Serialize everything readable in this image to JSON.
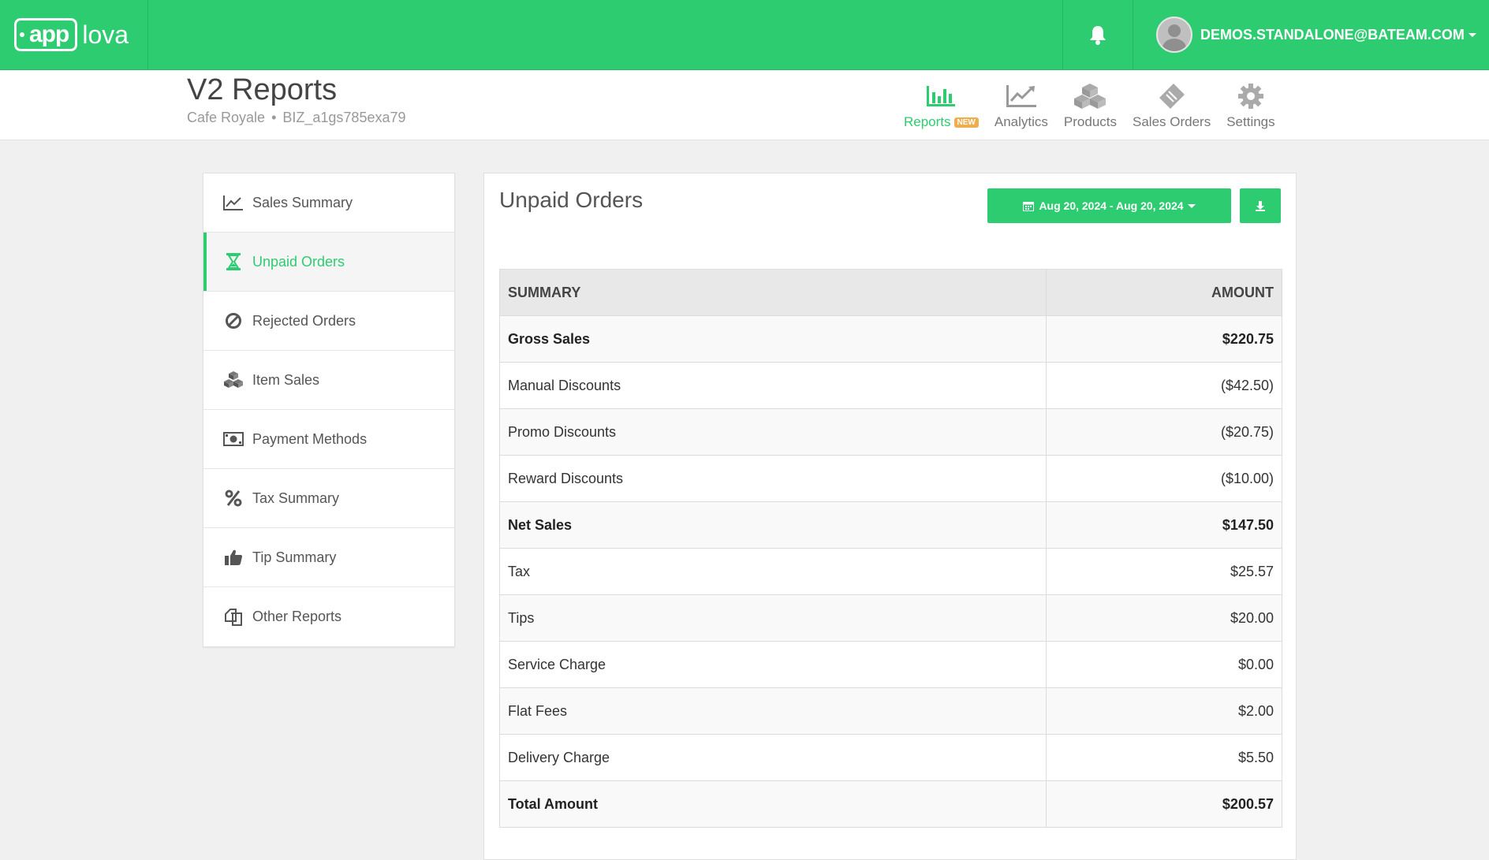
{
  "brand": {
    "logo_app": "app",
    "logo_rest": "lova"
  },
  "user": {
    "email": "DEMOS.STANDALONE@BATEAM.COM"
  },
  "header": {
    "title": "V2 Reports",
    "business": "Cafe Royale",
    "business_id": "BIZ_a1gs785exa79"
  },
  "nav": [
    {
      "label": "Reports",
      "badge": "NEW",
      "icon": "bar-chart-icon",
      "active": true
    },
    {
      "label": "Analytics",
      "icon": "line-chart-icon"
    },
    {
      "label": "Products",
      "icon": "cubes-icon"
    },
    {
      "label": "Sales Orders",
      "icon": "ticket-icon"
    },
    {
      "label": "Settings",
      "icon": "gear-icon"
    }
  ],
  "sidebar": {
    "items": [
      {
        "label": "Sales Summary",
        "icon": "line-chart-icon"
      },
      {
        "label": "Unpaid Orders",
        "icon": "hourglass-icon",
        "active": true
      },
      {
        "label": "Rejected Orders",
        "icon": "ban-icon"
      },
      {
        "label": "Item Sales",
        "icon": "cubes-icon"
      },
      {
        "label": "Payment Methods",
        "icon": "money-icon"
      },
      {
        "label": "Tax Summary",
        "icon": "percent-icon"
      },
      {
        "label": "Tip Summary",
        "icon": "thumbs-up-icon"
      },
      {
        "label": "Other Reports",
        "icon": "copy-icon"
      }
    ]
  },
  "main": {
    "title": "Unpaid Orders",
    "date_range": "Aug 20, 2024 - Aug 20, 2024",
    "table": {
      "headers": [
        "SUMMARY",
        "AMOUNT"
      ],
      "rows": [
        {
          "label": "Gross Sales",
          "amount": "$220.75",
          "bold": true
        },
        {
          "label": "Manual Discounts",
          "amount": "($42.50)"
        },
        {
          "label": "Promo Discounts",
          "amount": "($20.75)"
        },
        {
          "label": "Reward Discounts",
          "amount": "($10.00)"
        },
        {
          "label": "Net Sales",
          "amount": "$147.50",
          "bold": true
        },
        {
          "label": "Tax",
          "amount": "$25.57"
        },
        {
          "label": "Tips",
          "amount": "$20.00"
        },
        {
          "label": "Service Charge",
          "amount": "$0.00"
        },
        {
          "label": "Flat Fees",
          "amount": "$2.00"
        },
        {
          "label": "Delivery Charge",
          "amount": "$5.50"
        },
        {
          "label": "Total Amount",
          "amount": "$200.57",
          "bold": true
        }
      ]
    }
  },
  "colors": {
    "accent": "#2ecc71",
    "badge": "#f0ad4e"
  }
}
